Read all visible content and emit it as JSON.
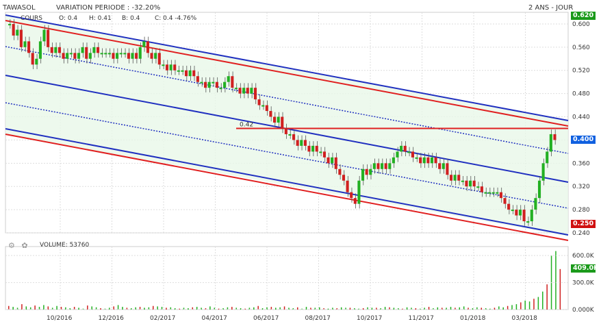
{
  "header": {
    "symbol": "TAWASOL",
    "variation": "VARIATION PERIODE : -32.20%",
    "period": "2 ANS - JOUR",
    "ohlc_label": "COURS",
    "open": "O: 0.4",
    "high": "H: 0.41",
    "low": "B: 0.4",
    "close": "C: 0.4 -4.76%"
  },
  "volume_panel": {
    "label": "VOLUME: 53760",
    "icons": [
      "gear-icon",
      "settings-icon"
    ]
  },
  "price_tags": {
    "top": {
      "value": "0.620",
      "color": "#1a9a1a"
    },
    "current": {
      "value": "0.400",
      "color": "#1060e0"
    },
    "bottom": {
      "value": "0.250",
      "color": "#d01010"
    },
    "volume": {
      "value": "409.0K",
      "color": "#1a9a1a"
    }
  },
  "annotation": {
    "label": "0.42"
  },
  "chart_data": [
    {
      "type": "candlestick",
      "title": "TAWASOL",
      "ylim": [
        0.24,
        0.62
      ],
      "y_ticks": [
        "0.600",
        "0.560",
        "0.520",
        "0.480",
        "0.440",
        "0.400",
        "0.360",
        "0.320",
        "0.280",
        "0.240"
      ],
      "x_ticks": [
        "10/2016",
        "12/2016",
        "02/2017",
        "04/2017",
        "06/2017",
        "08/2017",
        "10/2017",
        "11/2017",
        "01/2018",
        "03/2018"
      ],
      "series": [
        {
          "closes": [
            0.6,
            0.58,
            0.59,
            0.56,
            0.57,
            0.55,
            0.53,
            0.54,
            0.57,
            0.59,
            0.56,
            0.55,
            0.56,
            0.55,
            0.54,
            0.55,
            0.55,
            0.54,
            0.55,
            0.56,
            0.54,
            0.55,
            0.56,
            0.55,
            0.55,
            0.55,
            0.55,
            0.54,
            0.55,
            0.55,
            0.55,
            0.54,
            0.55,
            0.54,
            0.56,
            0.57,
            0.55,
            0.54,
            0.55,
            0.53,
            0.53,
            0.52,
            0.53,
            0.52,
            0.52,
            0.52,
            0.51,
            0.52,
            0.51,
            0.5,
            0.5,
            0.49,
            0.5,
            0.5,
            0.49,
            0.49,
            0.5,
            0.51,
            0.49,
            0.49,
            0.48,
            0.49,
            0.48,
            0.49,
            0.47,
            0.46,
            0.46,
            0.45,
            0.44,
            0.43,
            0.44,
            0.42,
            0.41,
            0.41,
            0.4,
            0.39,
            0.4,
            0.39,
            0.38,
            0.39,
            0.38,
            0.38,
            0.37,
            0.36,
            0.37,
            0.35,
            0.34,
            0.33,
            0.31,
            0.3,
            0.29,
            0.33,
            0.35,
            0.34,
            0.35,
            0.36,
            0.35,
            0.36,
            0.35,
            0.36,
            0.37,
            0.38,
            0.39,
            0.38,
            0.38,
            0.37,
            0.37,
            0.36,
            0.37,
            0.36,
            0.37,
            0.36,
            0.35,
            0.36,
            0.34,
            0.33,
            0.34,
            0.33,
            0.33,
            0.32,
            0.33,
            0.32,
            0.32,
            0.31,
            0.31,
            0.31,
            0.31,
            0.31,
            0.3,
            0.29,
            0.28,
            0.28,
            0.27,
            0.28,
            0.26,
            0.26,
            0.28,
            0.3,
            0.33,
            0.36,
            0.38,
            0.41,
            0.4
          ]
        }
      ],
      "annotations": [
        {
          "type": "hline",
          "value": 0.42,
          "label": "0.42"
        }
      ],
      "channels": [
        {
          "style": "solid",
          "color": "#2030c0"
        },
        {
          "style": "solid",
          "color": "#e02020"
        },
        {
          "style": "dotted",
          "color": "#2030c0"
        }
      ]
    },
    {
      "type": "bar",
      "title": "VOLUME: 53760",
      "ylim": [
        0,
        700000
      ],
      "y_ticks": [
        "600.0K",
        "300.0K",
        "0.000K"
      ],
      "series": [
        {
          "name": "VOLUME",
          "values": [
            40,
            30,
            20,
            60,
            35,
            25,
            45,
            30,
            50,
            35,
            20,
            40,
            30,
            25,
            15,
            30,
            20,
            10,
            45,
            35,
            25,
            15,
            10,
            20,
            35,
            50,
            30,
            20,
            15,
            25,
            30,
            20,
            25,
            40,
            35,
            30,
            20,
            25,
            15,
            10,
            20,
            15,
            25,
            30,
            20,
            15,
            35,
            20,
            10,
            15,
            25,
            30,
            20,
            15,
            10,
            20,
            25,
            40,
            15,
            25,
            30,
            20,
            25,
            35,
            20,
            15,
            25,
            10,
            30,
            20,
            20,
            25,
            15,
            10,
            20,
            15,
            25,
            20,
            20,
            15,
            10,
            15,
            25,
            20,
            20,
            15,
            30,
            25,
            20,
            15,
            10,
            25,
            20,
            15,
            10,
            20,
            30,
            15,
            25,
            20,
            20,
            30,
            20,
            25,
            35,
            20,
            15,
            25,
            20,
            15,
            10,
            20,
            35,
            25,
            40,
            50,
            60,
            80,
            100,
            90,
            120,
            140,
            200,
            280,
            600,
            650,
            450
          ]
        }
      ]
    }
  ]
}
